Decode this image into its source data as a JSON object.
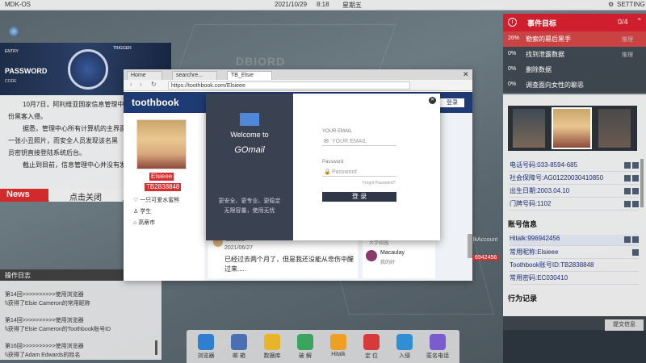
{
  "system_bar": {
    "app_name": "MDK-OS",
    "date": "2021/10/29",
    "time": "8:18",
    "weekday": "星期五",
    "setting_label": "SETTING"
  },
  "map_labels": [
    "DBIORD"
  ],
  "news": {
    "image_text": [
      "PASSWORD",
      "ENTRY",
      "TRIGGER",
      "CODE"
    ],
    "paragraphs": [
      "10月7日，阿利维亚国家信息管理中",
      "份黑客入侵。",
      "据悉，管理中心所有计算机的主界面",
      "一张小丑照片，而安全人员发现该名黑",
      "员密钥直接登陆系统后台。",
      "截止到目前，信息管理中心并没有发"
    ],
    "label": "News",
    "close_label": "点击关闭"
  },
  "log": {
    "title": "操作日志",
    "lines": [
      "第14回>>>>>>>>>>使用浏览器",
      "\\\\获得了Elsie Cameron的常用昵称",
      "第14回>>>>>>>>>>使用浏览器",
      "\\\\获得了Elsie Cameron的Toothbook账号ID",
      "第16回>>>>>>>>>>使用浏览器",
      "\\\\获得了Adam Edwards的姓名"
    ]
  },
  "browser": {
    "tabs": [
      "Home",
      "searchre...",
      "TB_Elsie"
    ],
    "url": "https://toothbook.com/Elsieee",
    "site_logo": "toothbook",
    "login_label": "登录",
    "profile": {
      "name": "Elsieee",
      "id": "TB2838848",
      "bio": "一只可爱水蜜熊",
      "job": "学生",
      "city": "高蒂市"
    },
    "post": {
      "author": "Elsieee",
      "date": "2021/06/27",
      "text": [
        "已经过去两个月了，但是我还没能从悲伤中醒",
        "过来....."
      ]
    },
    "side_user": {
      "note": "大学校园",
      "name": "Macaulay",
      "sub": "我的好"
    }
  },
  "gomail": {
    "welcome": "Welcome to",
    "brand": "GOmail",
    "slogan": [
      "更安全、更专业、更稳定",
      "无限容量，使用无忧"
    ],
    "email_label": "YOUR EMAIL",
    "email_placeholder": "YOUR EMAIL",
    "password_label": "Password",
    "password_placeholder": "Password",
    "forgot": "Forgot Password?",
    "login_button": "登 录"
  },
  "events": {
    "title": "事件目标",
    "progress": "0/4",
    "items": [
      {
        "pct": "26%",
        "title": "勒索的幕后黑手",
        "tag": "推理"
      },
      {
        "pct": "0%",
        "title": "找到泄露数据",
        "tag": "推理"
      },
      {
        "pct": "0%",
        "title": "删除数据",
        "tag": ""
      },
      {
        "pct": "0%",
        "title": "调查面向女性的聊恶",
        "tag": ""
      }
    ]
  },
  "info": {
    "personal": [
      "电话号码:033-8594-685",
      "社会保障号:AG01220030410850",
      "出生日期:2003.04.10",
      "门牌号码:1102"
    ],
    "account_title": "账号信息",
    "account": [
      "Hitalk:996942456",
      "常用昵称:Elsieee",
      "Toothbook账号ID:TB2838848",
      "常用密码:EC030410"
    ],
    "behavior_title": "行为记录",
    "partial_account_left": "lkAccount",
    "partial_number_left": "6942456"
  },
  "bottom": {
    "save_label": "提交信息"
  },
  "dock": [
    {
      "label": "浏览器",
      "color": "#2f7fd0"
    },
    {
      "label": "邮 箱",
      "color": "#4a6fb5"
    },
    {
      "label": "数据库",
      "color": "#e8b42a"
    },
    {
      "label": "破 解",
      "color": "#3aa55c"
    },
    {
      "label": "Hitalk",
      "color": "#f0a020"
    },
    {
      "label": "定 位",
      "color": "#d83a3a"
    },
    {
      "label": "入侵",
      "color": "#2e8fd4"
    },
    {
      "label": "匿名电话",
      "color": "#7a5bd0"
    }
  ]
}
